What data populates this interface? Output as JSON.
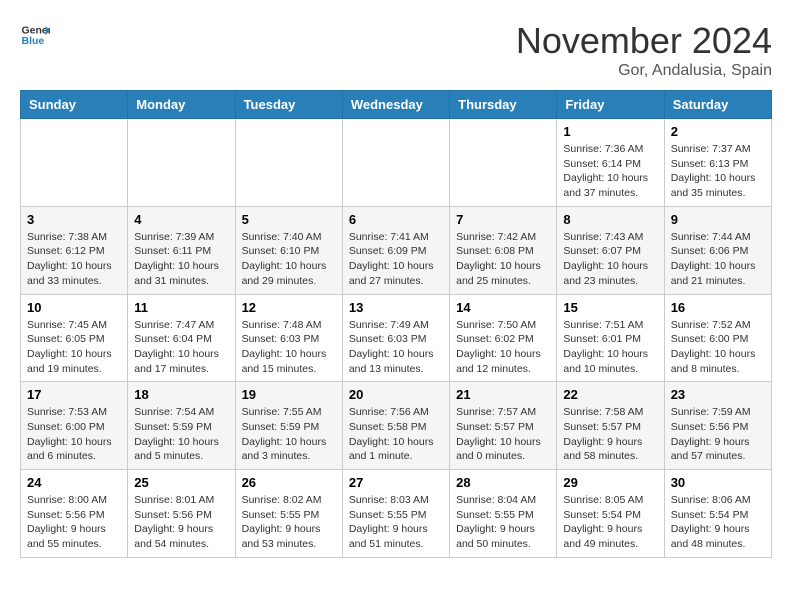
{
  "header": {
    "logo_general": "General",
    "logo_blue": "Blue",
    "month_title": "November 2024",
    "location": "Gor, Andalusia, Spain"
  },
  "weekdays": [
    "Sunday",
    "Monday",
    "Tuesday",
    "Wednesday",
    "Thursday",
    "Friday",
    "Saturday"
  ],
  "weeks": [
    [
      {
        "day": "",
        "info": ""
      },
      {
        "day": "",
        "info": ""
      },
      {
        "day": "",
        "info": ""
      },
      {
        "day": "",
        "info": ""
      },
      {
        "day": "",
        "info": ""
      },
      {
        "day": "1",
        "info": "Sunrise: 7:36 AM\nSunset: 6:14 PM\nDaylight: 10 hours and 37 minutes."
      },
      {
        "day": "2",
        "info": "Sunrise: 7:37 AM\nSunset: 6:13 PM\nDaylight: 10 hours and 35 minutes."
      }
    ],
    [
      {
        "day": "3",
        "info": "Sunrise: 7:38 AM\nSunset: 6:12 PM\nDaylight: 10 hours and 33 minutes."
      },
      {
        "day": "4",
        "info": "Sunrise: 7:39 AM\nSunset: 6:11 PM\nDaylight: 10 hours and 31 minutes."
      },
      {
        "day": "5",
        "info": "Sunrise: 7:40 AM\nSunset: 6:10 PM\nDaylight: 10 hours and 29 minutes."
      },
      {
        "day": "6",
        "info": "Sunrise: 7:41 AM\nSunset: 6:09 PM\nDaylight: 10 hours and 27 minutes."
      },
      {
        "day": "7",
        "info": "Sunrise: 7:42 AM\nSunset: 6:08 PM\nDaylight: 10 hours and 25 minutes."
      },
      {
        "day": "8",
        "info": "Sunrise: 7:43 AM\nSunset: 6:07 PM\nDaylight: 10 hours and 23 minutes."
      },
      {
        "day": "9",
        "info": "Sunrise: 7:44 AM\nSunset: 6:06 PM\nDaylight: 10 hours and 21 minutes."
      }
    ],
    [
      {
        "day": "10",
        "info": "Sunrise: 7:45 AM\nSunset: 6:05 PM\nDaylight: 10 hours and 19 minutes."
      },
      {
        "day": "11",
        "info": "Sunrise: 7:47 AM\nSunset: 6:04 PM\nDaylight: 10 hours and 17 minutes."
      },
      {
        "day": "12",
        "info": "Sunrise: 7:48 AM\nSunset: 6:03 PM\nDaylight: 10 hours and 15 minutes."
      },
      {
        "day": "13",
        "info": "Sunrise: 7:49 AM\nSunset: 6:03 PM\nDaylight: 10 hours and 13 minutes."
      },
      {
        "day": "14",
        "info": "Sunrise: 7:50 AM\nSunset: 6:02 PM\nDaylight: 10 hours and 12 minutes."
      },
      {
        "day": "15",
        "info": "Sunrise: 7:51 AM\nSunset: 6:01 PM\nDaylight: 10 hours and 10 minutes."
      },
      {
        "day": "16",
        "info": "Sunrise: 7:52 AM\nSunset: 6:00 PM\nDaylight: 10 hours and 8 minutes."
      }
    ],
    [
      {
        "day": "17",
        "info": "Sunrise: 7:53 AM\nSunset: 6:00 PM\nDaylight: 10 hours and 6 minutes."
      },
      {
        "day": "18",
        "info": "Sunrise: 7:54 AM\nSunset: 5:59 PM\nDaylight: 10 hours and 5 minutes."
      },
      {
        "day": "19",
        "info": "Sunrise: 7:55 AM\nSunset: 5:59 PM\nDaylight: 10 hours and 3 minutes."
      },
      {
        "day": "20",
        "info": "Sunrise: 7:56 AM\nSunset: 5:58 PM\nDaylight: 10 hours and 1 minute."
      },
      {
        "day": "21",
        "info": "Sunrise: 7:57 AM\nSunset: 5:57 PM\nDaylight: 10 hours and 0 minutes."
      },
      {
        "day": "22",
        "info": "Sunrise: 7:58 AM\nSunset: 5:57 PM\nDaylight: 9 hours and 58 minutes."
      },
      {
        "day": "23",
        "info": "Sunrise: 7:59 AM\nSunset: 5:56 PM\nDaylight: 9 hours and 57 minutes."
      }
    ],
    [
      {
        "day": "24",
        "info": "Sunrise: 8:00 AM\nSunset: 5:56 PM\nDaylight: 9 hours and 55 minutes."
      },
      {
        "day": "25",
        "info": "Sunrise: 8:01 AM\nSunset: 5:56 PM\nDaylight: 9 hours and 54 minutes."
      },
      {
        "day": "26",
        "info": "Sunrise: 8:02 AM\nSunset: 5:55 PM\nDaylight: 9 hours and 53 minutes."
      },
      {
        "day": "27",
        "info": "Sunrise: 8:03 AM\nSunset: 5:55 PM\nDaylight: 9 hours and 51 minutes."
      },
      {
        "day": "28",
        "info": "Sunrise: 8:04 AM\nSunset: 5:55 PM\nDaylight: 9 hours and 50 minutes."
      },
      {
        "day": "29",
        "info": "Sunrise: 8:05 AM\nSunset: 5:54 PM\nDaylight: 9 hours and 49 minutes."
      },
      {
        "day": "30",
        "info": "Sunrise: 8:06 AM\nSunset: 5:54 PM\nDaylight: 9 hours and 48 minutes."
      }
    ]
  ]
}
